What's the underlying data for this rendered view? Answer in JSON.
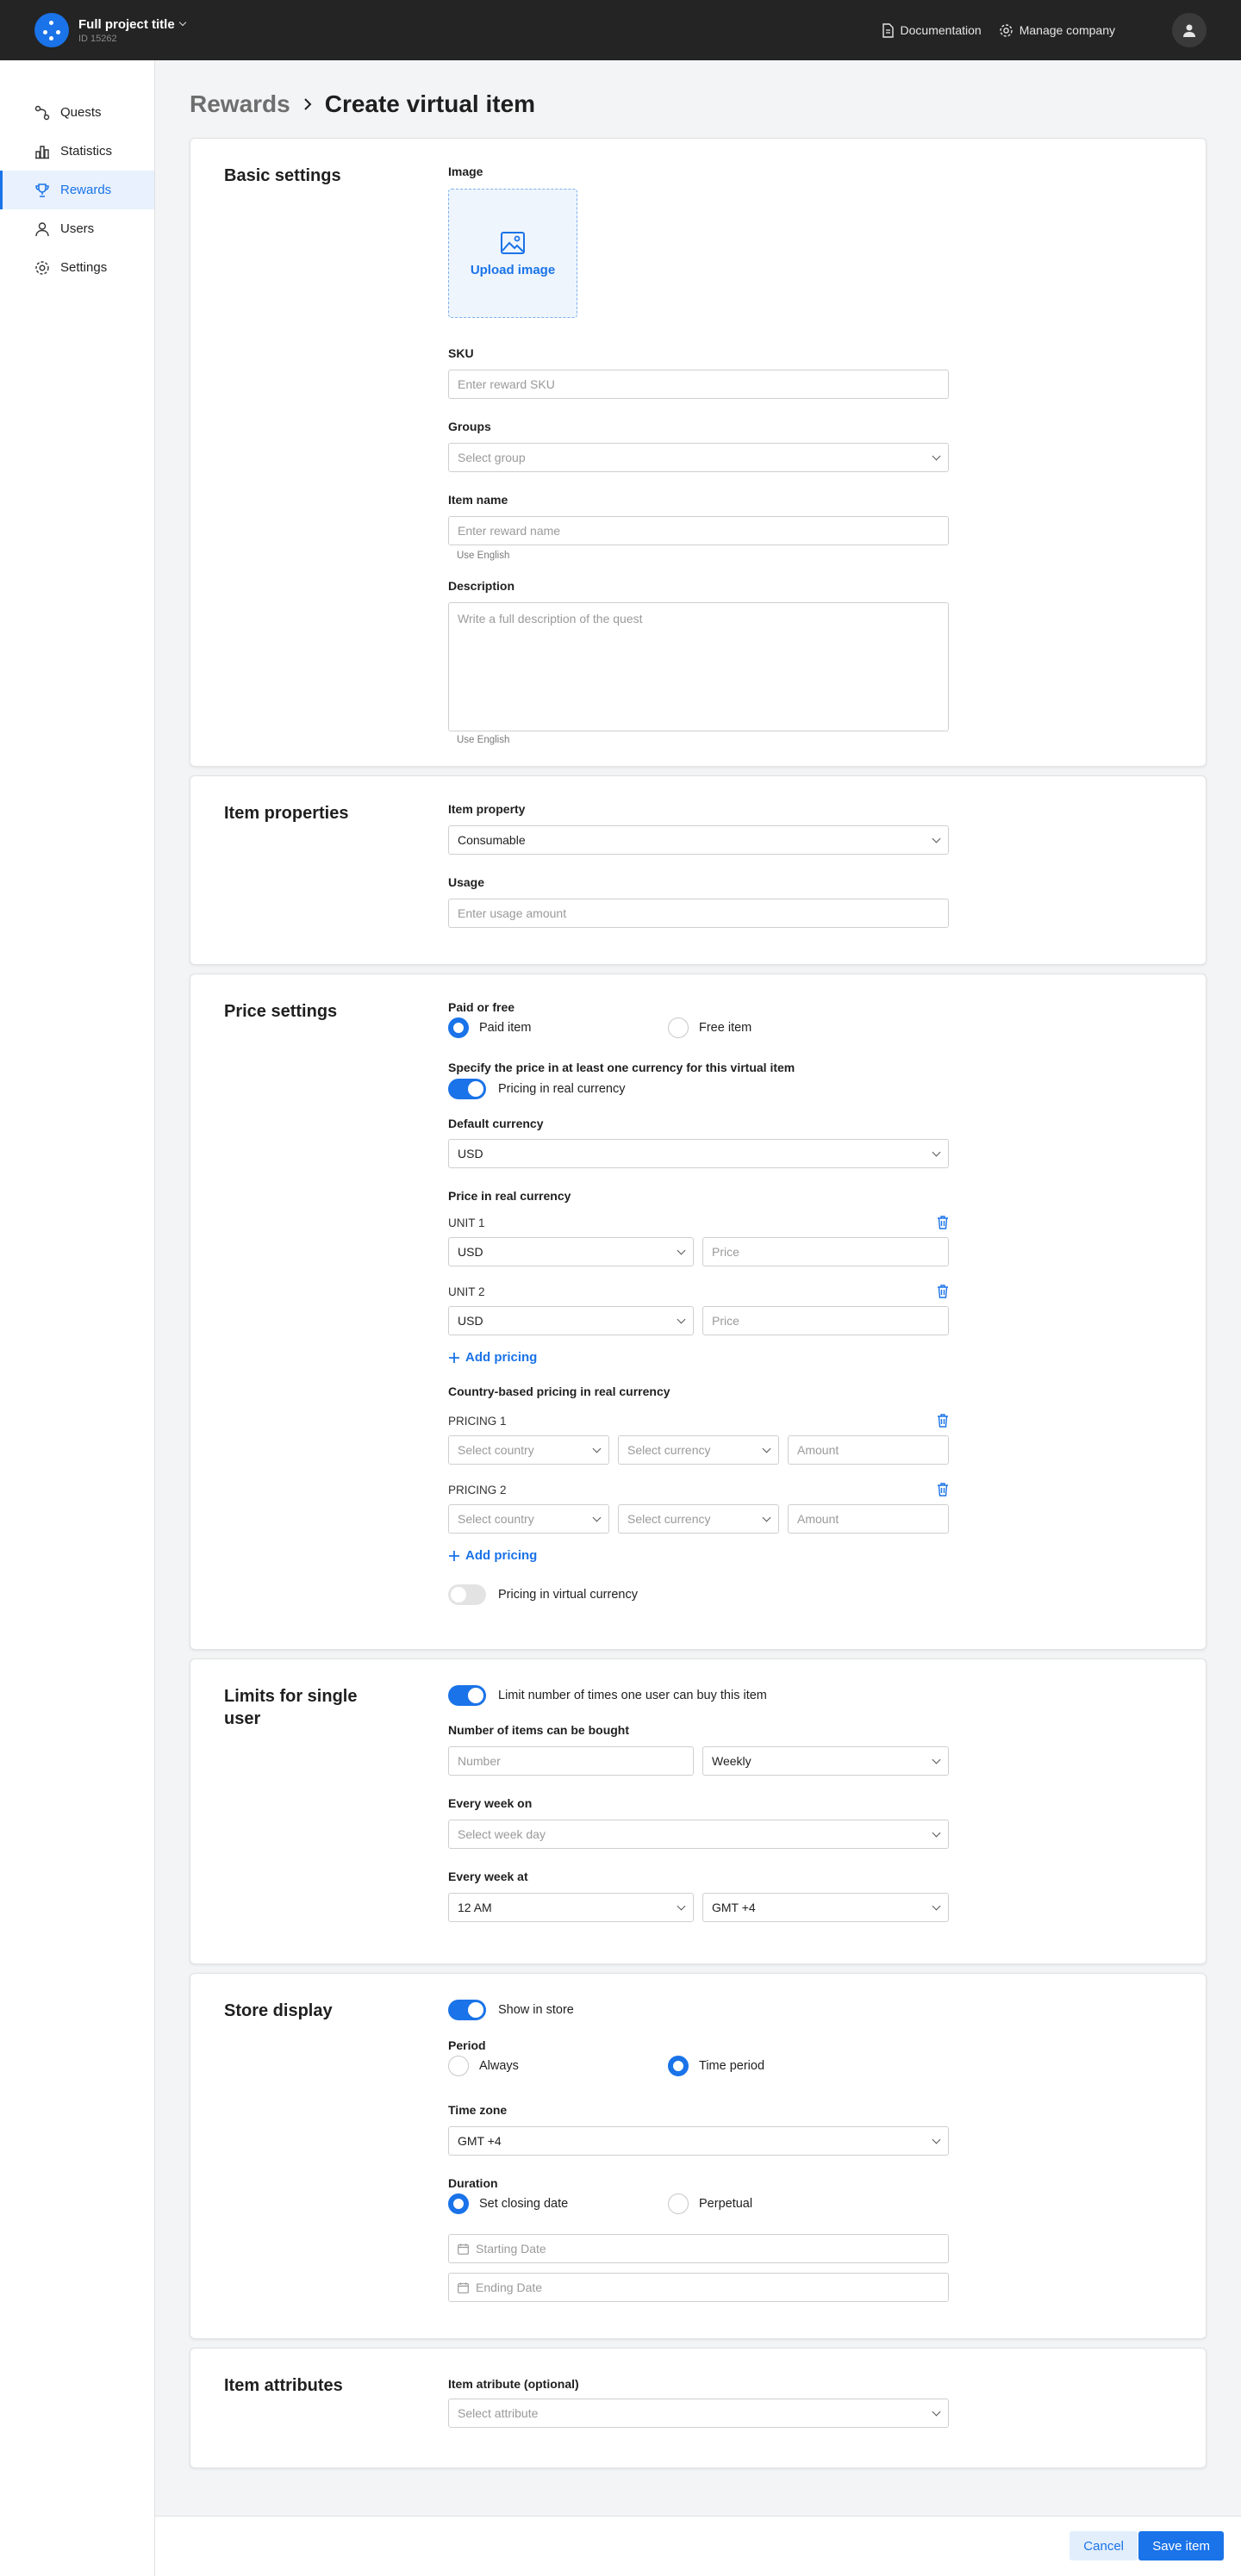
{
  "header": {
    "project_title": "Full project title",
    "project_id": "ID 15262",
    "documentation": "Documentation",
    "manage_company": "Manage company"
  },
  "sidebar": {
    "items": [
      {
        "label": "Quests",
        "icon": "quests-icon"
      },
      {
        "label": "Statistics",
        "icon": "statistics-icon"
      },
      {
        "label": "Rewards",
        "icon": "trophy-icon",
        "active": true
      },
      {
        "label": "Users",
        "icon": "user-icon"
      },
      {
        "label": "Settings",
        "icon": "gear-icon"
      }
    ]
  },
  "breadcrumb": {
    "parent": "Rewards",
    "current": "Create virtual item"
  },
  "basic": {
    "title": "Basic settings",
    "image_label": "Image",
    "upload": "Upload image",
    "sku_label": "SKU",
    "sku_placeholder": "Enter reward SKU",
    "groups_label": "Groups",
    "groups_placeholder": "Select group",
    "name_label": "Item name",
    "name_placeholder": "Enter reward name",
    "name_hint": "Use English",
    "desc_label": "Description",
    "desc_placeholder": "Write a full description of the quest",
    "desc_hint": "Use English"
  },
  "props": {
    "title": "Item properties",
    "property_label": "Item property",
    "property_value": "Consumable",
    "usage_label": "Usage",
    "usage_placeholder": "Enter usage amount"
  },
  "price": {
    "title": "Price settings",
    "paid_free_label": "Paid or free",
    "paid": "Paid item",
    "free": "Free item",
    "specify": "Specify the price in at least one currency for this virtual item",
    "real_toggle": "Pricing in real currency",
    "default_currency_label": "Default currency",
    "default_currency_value": "USD",
    "real_price_label": "Price in real currency",
    "units": [
      {
        "label": "UNIT 1",
        "currency": "USD",
        "price_placeholder": "Price"
      },
      {
        "label": "UNIT 2",
        "currency": "USD",
        "price_placeholder": "Price"
      }
    ],
    "add_pricing": "Add pricing",
    "country_label": "Country-based pricing in real currency",
    "pricings": [
      {
        "label": "PRICING 1",
        "country": "Select country",
        "currency": "Select currency",
        "amount": "Amount"
      },
      {
        "label": "PRICING 2",
        "country": "Select country",
        "currency": "Select currency",
        "amount": "Amount"
      }
    ],
    "add_pricing_2": "Add pricing",
    "virtual_toggle": "Pricing in virtual currency"
  },
  "limits": {
    "title": "Limits for single user",
    "toggle": "Limit number of times one user can buy this item",
    "number_label": "Number of items can be bought",
    "number_placeholder": "Number",
    "frequency": "Weekly",
    "week_on_label": "Every week on",
    "week_on_placeholder": "Select week day",
    "week_at_label": "Every week at",
    "time": "12 AM",
    "tz": "GMT +4"
  },
  "store": {
    "title": "Store display",
    "toggle": "Show in store",
    "period_label": "Period",
    "always": "Always",
    "time_period": "Time period",
    "tz_label": "Time zone",
    "tz_value": "GMT +4",
    "duration_label": "Duration",
    "closing": "Set closing date",
    "perpetual": "Perpetual",
    "start_placeholder": "Starting Date",
    "end_placeholder": "Ending Date"
  },
  "attributes": {
    "title": "Item attributes",
    "label": "Item atribute (optional)",
    "placeholder": "Select attribute"
  },
  "footer": {
    "cancel": "Cancel",
    "save": "Save item"
  },
  "colors": {
    "accent": "#1a73e8",
    "topbar": "#242424"
  }
}
